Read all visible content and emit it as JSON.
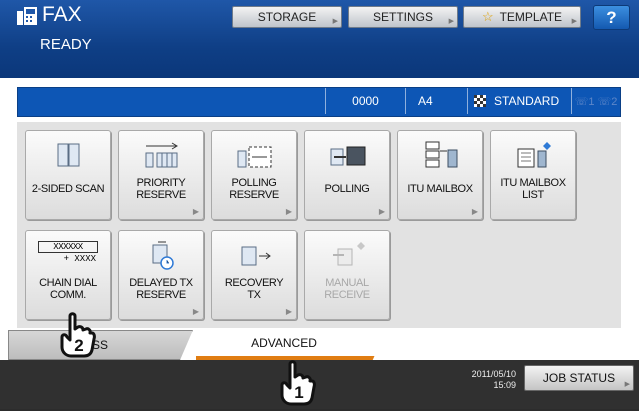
{
  "header": {
    "app_title": "FAX",
    "status": "READY",
    "buttons": {
      "storage": "STORAGE",
      "settings": "SETTINGS",
      "template": "TEMPLATE",
      "help": "?"
    }
  },
  "info_bar": {
    "counter": "0000",
    "paper_size": "A4",
    "resolution": "STANDARD"
  },
  "functions": [
    {
      "label": "2-SIDED SCAN",
      "icon": "duplex-scan-icon"
    },
    {
      "label": "PRIORITY\nRESERVE",
      "icon": "priority-reserve-icon"
    },
    {
      "label": "POLLING\nRESERVE",
      "icon": "polling-reserve-icon"
    },
    {
      "label": "POLLING",
      "icon": "polling-icon"
    },
    {
      "label": "ITU MAILBOX",
      "icon": "itu-mailbox-icon"
    },
    {
      "label": "ITU MAILBOX\nLIST",
      "icon": "itu-mailbox-list-icon"
    },
    {
      "label": "CHAIN DIAL\nCOMM.",
      "icon": "chain-dial-icon",
      "icon_text_1": "XXXXXX",
      "icon_text_2": "+ XXXX"
    },
    {
      "label": "DELAYED TX\nRESERVE",
      "icon": "delayed-tx-icon"
    },
    {
      "label": "RECOVERY\nTX",
      "icon": "recovery-tx-icon"
    },
    {
      "label": "MANUAL\nRECEIVE",
      "icon": "manual-receive-icon"
    }
  ],
  "tabs": {
    "address": "ESS",
    "advanced": "ADVANCED"
  },
  "footer": {
    "date": "2011/05/10",
    "time": "15:09",
    "job_status": "JOB STATUS"
  },
  "callouts": {
    "step1": "1",
    "step2": "2"
  },
  "colors": {
    "header_blue": "#1f57a8",
    "info_bar_blue": "#0d56b5",
    "tab_accent": "#e07d12"
  }
}
